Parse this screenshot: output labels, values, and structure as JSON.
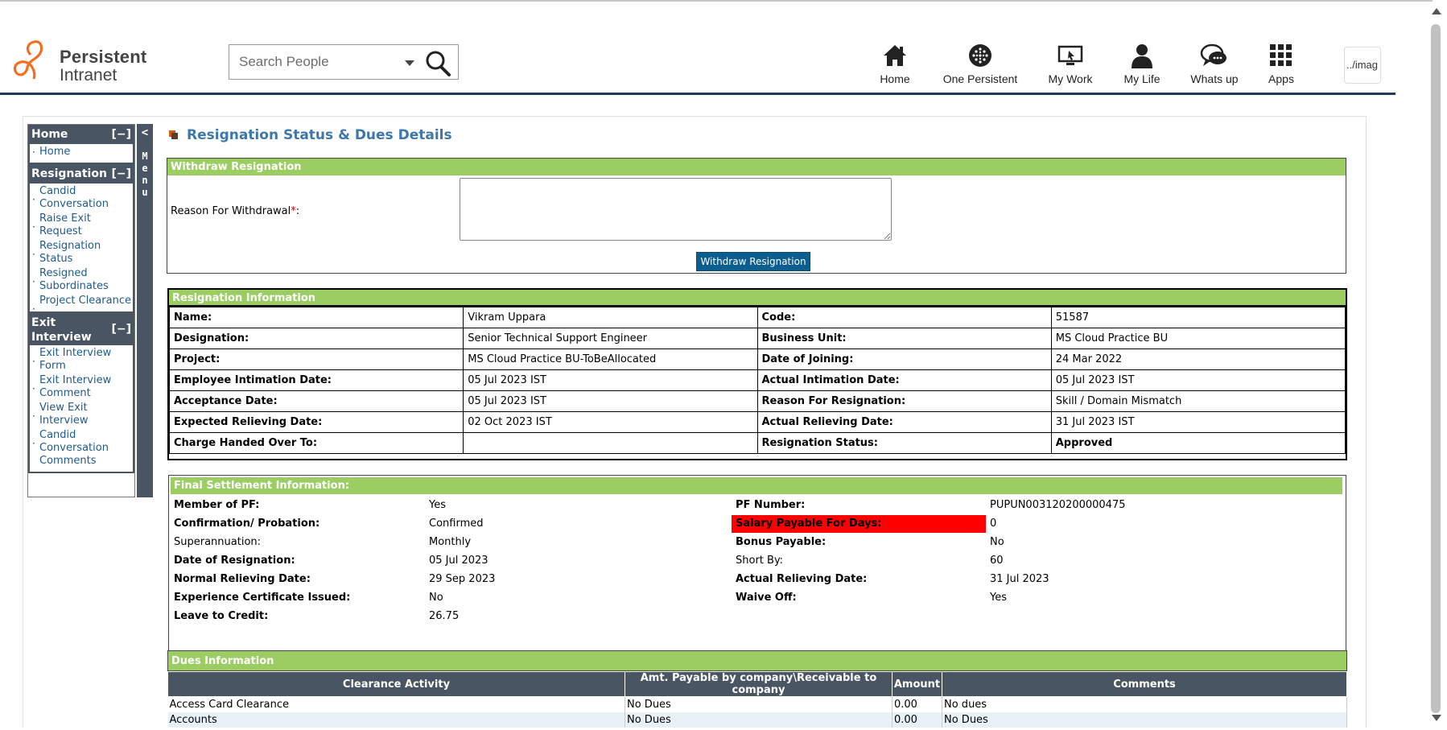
{
  "header": {
    "logo_line1": "Persistent",
    "logo_line2": "Intranet",
    "search_placeholder": "Search People",
    "nav": [
      {
        "label": "Home",
        "icon": "home-icon"
      },
      {
        "label": "One Persistent",
        "icon": "globe-icon"
      },
      {
        "label": "My Work",
        "icon": "monitor-icon"
      },
      {
        "label": "My Life",
        "icon": "person-icon"
      },
      {
        "label": "Whats up",
        "icon": "chat-icon"
      },
      {
        "label": "Apps",
        "icon": "grid-icon"
      }
    ],
    "avatar_alt": "../imag"
  },
  "sidebar": {
    "sections": [
      {
        "title": "Home",
        "toggle": "[−]",
        "items": [
          "Home"
        ]
      },
      {
        "title": "Resignation",
        "toggle": "[−]",
        "items": [
          "Candid Conversation",
          "Raise Exit Request",
          "Resignation Status",
          "Resigned Subordinates",
          "Project Clearance"
        ]
      },
      {
        "title": "Exit Interview",
        "toggle": "[−]",
        "items": [
          "Exit Interview Form",
          "Exit Interview Comment",
          "View Exit Interview",
          "Candid Conversation Comments"
        ]
      }
    ],
    "menu_arrow": "<",
    "menu_label": "Menu"
  },
  "page_title": "Resignation Status & Dues Details",
  "withdraw": {
    "heading": "Withdraw Resignation",
    "reason_label": "Reason For Withdrawal",
    "required_mark": "*",
    "reason_colon": ":",
    "reason_value": "",
    "button_label": "Withdraw Resignation"
  },
  "resignation_info": {
    "heading": "Resignation Information",
    "rows": [
      [
        "Name:",
        "Vikram Uppara",
        "Code:",
        "51587"
      ],
      [
        "Designation:",
        "Senior Technical Support Engineer",
        "Business Unit:",
        "MS Cloud Practice BU"
      ],
      [
        "Project:",
        "MS Cloud Practice BU-ToBeAllocated",
        "Date of Joining:",
        "24 Mar 2022"
      ],
      [
        "Employee Intimation Date:",
        "05 Jul 2023 IST",
        "Actual Intimation Date:",
        "05 Jul 2023 IST"
      ],
      [
        "Acceptance Date:",
        "05 Jul 2023 IST",
        "Reason For Resignation:",
        "Skill / Domain Mismatch"
      ],
      [
        "Expected Relieving Date:",
        "02 Oct 2023 IST",
        "Actual Relieving Date:",
        "31 Jul 2023 IST"
      ],
      [
        "Charge Handed Over To:",
        "",
        "Resignation Status:",
        "Approved"
      ]
    ]
  },
  "final_settlement": {
    "heading": "Final Settlement Information:",
    "left": [
      {
        "label": "Member of PF:",
        "value": "Yes",
        "bold": true
      },
      {
        "label": "Confirmation/ Probation:",
        "value": "Confirmed",
        "bold": true
      },
      {
        "label": "Superannuation:",
        "value": "Monthly",
        "bold": false
      },
      {
        "label": "Date of Resignation:",
        "value": "05 Jul 2023",
        "bold": true
      },
      {
        "label": "Normal Relieving Date:",
        "value": "29 Sep 2023",
        "bold": true
      },
      {
        "label": "Experience Certificate Issued:",
        "value": "No",
        "bold": true
      },
      {
        "label": "Leave to Credit:",
        "value": "26.75",
        "bold": true
      }
    ],
    "right": [
      {
        "label": "PF Number:",
        "value": "PUPUN003120200000475",
        "bold": true
      },
      {
        "label": "Salary Payable For Days:",
        "value": "0",
        "bold": true,
        "highlight": "#ff0000"
      },
      {
        "label": "Bonus Payable:",
        "value": "No",
        "bold": true
      },
      {
        "label": "Short By:",
        "value": "60",
        "bold": false
      },
      {
        "label": "Actual Relieving Date:",
        "value": "31 Jul 2023",
        "bold": true
      },
      {
        "label": "Waive Off:",
        "value": "Yes",
        "bold": true
      }
    ]
  },
  "dues": {
    "heading": "Dues Information",
    "columns": [
      "Clearance Activity",
      "Amt. Payable by company\\Receivable to company",
      "Amount",
      "Comments"
    ],
    "rows": [
      [
        "Access Card Clearance",
        "No Dues",
        "0.00",
        "No dues"
      ],
      [
        "Accounts",
        "No Dues",
        "0.00",
        "No Dues"
      ]
    ]
  },
  "colors": {
    "section_green": "#9bcd63",
    "dark_slate": "#4a5563",
    "button_blue": "#0d5d8f",
    "title_blue": "#3d77ab",
    "alert_red": "#ff0000"
  }
}
